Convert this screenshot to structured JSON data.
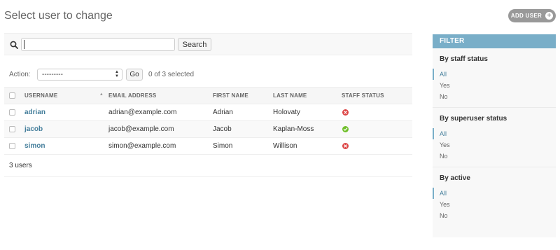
{
  "header": {
    "title": "Select user to change",
    "add_user_label": "ADD USER"
  },
  "search": {
    "value": "",
    "button_label": "Search"
  },
  "actions": {
    "label": "Action:",
    "selected_option": "---------",
    "go_label": "Go",
    "selected_text": "0 of 3 selected"
  },
  "table": {
    "columns": [
      "USERNAME",
      "EMAIL ADDRESS",
      "FIRST NAME",
      "LAST NAME",
      "STAFF STATUS"
    ],
    "rows": [
      {
        "username": "adrian",
        "email": "adrian@example.com",
        "first_name": "Adrian",
        "last_name": "Holovaty",
        "staff_status": "no"
      },
      {
        "username": "jacob",
        "email": "jacob@example.com",
        "first_name": "Jacob",
        "last_name": "Kaplan-Moss",
        "staff_status": "yes"
      },
      {
        "username": "simon",
        "email": "simon@example.com",
        "first_name": "Simon",
        "last_name": "Willison",
        "staff_status": "no"
      }
    ],
    "count_text": "3 users"
  },
  "filter": {
    "header": "FILTER",
    "groups": [
      {
        "title": "By staff status",
        "options": [
          "All",
          "Yes",
          "No"
        ],
        "selected": "All"
      },
      {
        "title": "By superuser status",
        "options": [
          "All",
          "Yes",
          "No"
        ],
        "selected": "All"
      },
      {
        "title": "By active",
        "options": [
          "All",
          "Yes",
          "No"
        ],
        "selected": "All"
      }
    ]
  },
  "colors": {
    "accent": "#79aec8",
    "link": "#447e9b",
    "status_yes": "#70bf2b",
    "status_no": "#dd4646",
    "button_gray": "#999999"
  },
  "icons": {
    "search": "search-icon",
    "add": "plus-icon",
    "status_yes": "check-icon",
    "status_no": "x-icon"
  }
}
